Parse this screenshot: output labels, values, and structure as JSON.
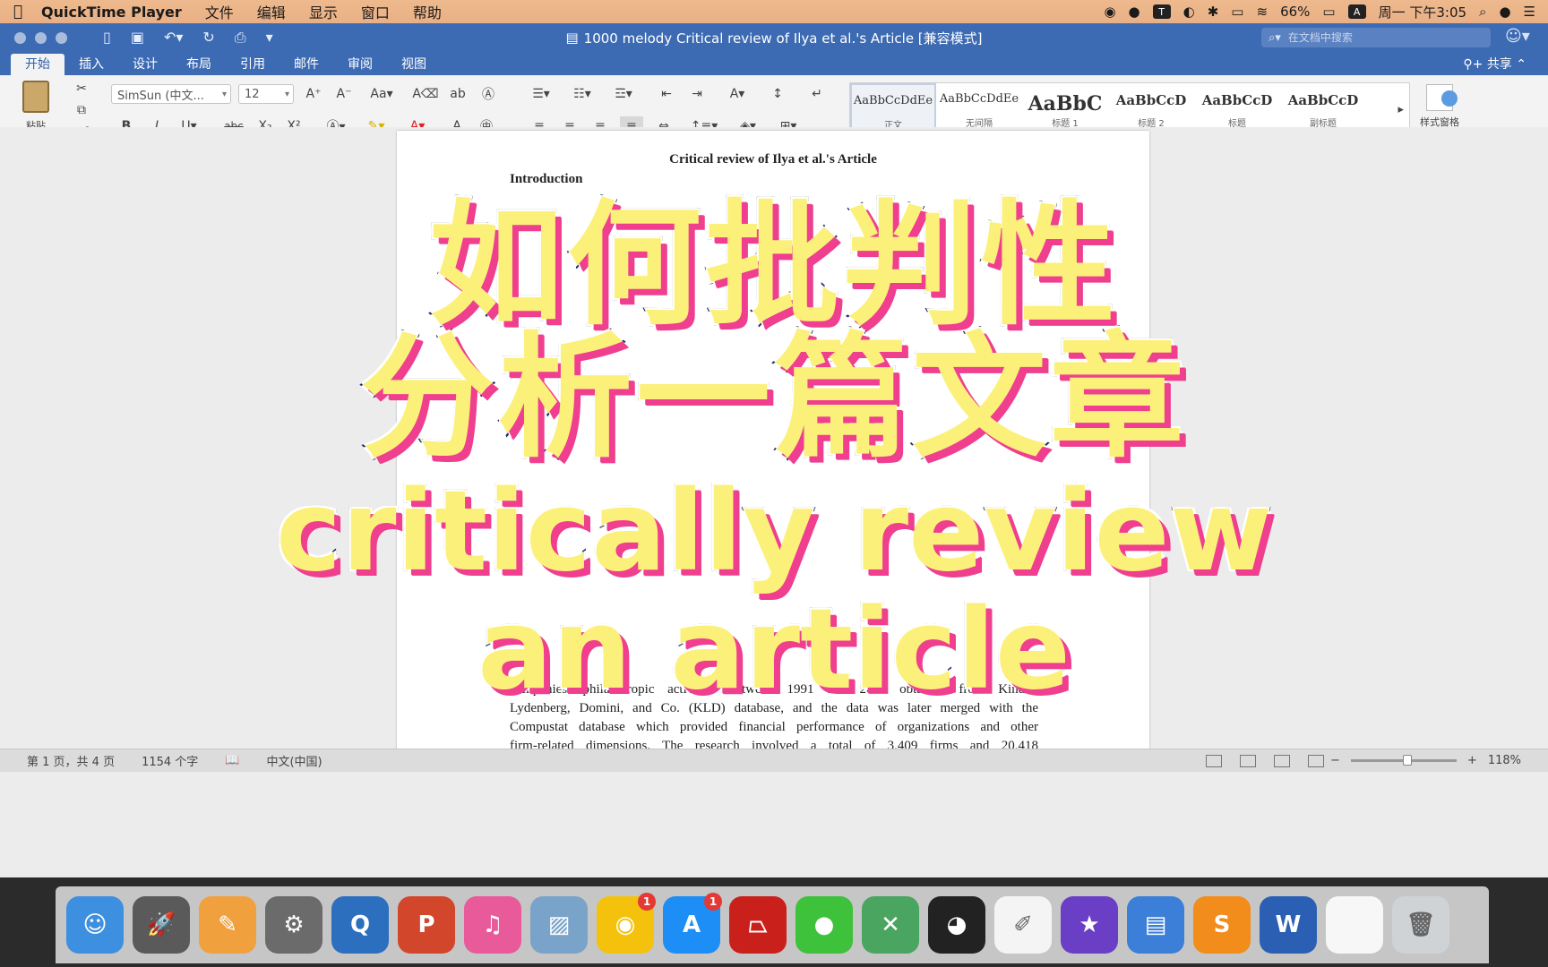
{
  "menubar": {
    "app_name": "QuickTime Player",
    "items": [
      "文件",
      "编辑",
      "显示",
      "窗口",
      "帮助"
    ],
    "battery": "66%",
    "clock": "周一 下午3:05"
  },
  "window": {
    "title": "1000 melody  Critical review of Ilya et al.'s Article [兼容模式]",
    "search_placeholder": "在文档中搜索",
    "tabs": [
      "开始",
      "插入",
      "设计",
      "布局",
      "引用",
      "邮件",
      "审阅",
      "视图"
    ],
    "share": "共享"
  },
  "ribbon": {
    "paste": "粘贴",
    "font_name": "SimSun (中文...",
    "font_size": "12",
    "styles": [
      {
        "sample": "AaBbCcDdEe",
        "name": "正文"
      },
      {
        "sample": "AaBbCcDdEe",
        "name": "无间隔"
      },
      {
        "sample": "AaBbC",
        "name": "标题 1"
      },
      {
        "sample": "AaBbCcD",
        "name": "标题 2"
      },
      {
        "sample": "AaBbCcD",
        "name": "标题"
      },
      {
        "sample": "AaBbCcD",
        "name": "副标题"
      }
    ],
    "style_pane": "样式窗格"
  },
  "document": {
    "title": "Critical review of Ilya et al.'s Article",
    "heading": "Introduction",
    "lines": [
      "companies' philanthropic activities between 1991 and 2009 obtained from Kinder,",
      "Lydenberg, Domini, and Co. (KLD) database, and the data was later merged with the",
      "Compustat database which provided financial performance of organizations and other",
      "firm-related dimensions. The research involved a total of 3,409 firms and 20,418"
    ]
  },
  "overlay": {
    "line1": "如何批判性",
    "line2": "分析一篇文章",
    "line3": "critically review",
    "line4": "an article"
  },
  "status": {
    "page": "第 1 页，共 4 页",
    "words": "1154 个字",
    "language": "中文(中国)",
    "zoom": "118%"
  },
  "dock": {
    "apps": [
      {
        "icon": "finder-icon",
        "color": "#3d8fe0"
      },
      {
        "icon": "launchpad-icon",
        "color": "#5a5a5a"
      },
      {
        "icon": "pages-icon",
        "color": "#f0a03c"
      },
      {
        "icon": "system-preferences-icon",
        "color": "#6b6b6b"
      },
      {
        "icon": "quicktime-icon",
        "color": "#2c6fbf"
      },
      {
        "icon": "powerpoint-icon",
        "color": "#d2472b"
      },
      {
        "icon": "itunes-icon",
        "color": "#e85a9a"
      },
      {
        "icon": "preview-icon",
        "color": "#7aa3c9"
      },
      {
        "icon": "chrome-icon",
        "color": "#f4c20d"
      },
      {
        "icon": "app-store-icon",
        "color": "#1d8ef5"
      },
      {
        "icon": "acrobat-icon",
        "color": "#c9201c"
      },
      {
        "icon": "wechat-icon",
        "color": "#3ec13b"
      },
      {
        "icon": "network-icon",
        "color": "#4aa561"
      },
      {
        "icon": "qq-icon",
        "color": "#222222"
      },
      {
        "icon": "textedit-icon",
        "color": "#f4f4f4"
      },
      {
        "icon": "imovie-icon",
        "color": "#6a3fc6"
      },
      {
        "icon": "keynote-icon",
        "color": "#3b7fd8"
      },
      {
        "icon": "sublime-icon",
        "color": "#f28c1b"
      },
      {
        "icon": "word-icon",
        "color": "#2b5fb3"
      },
      {
        "icon": "blank-window-icon",
        "color": "#f7f7f7"
      },
      {
        "icon": "trash-icon",
        "color": "#cfd3d6"
      }
    ],
    "badges": {
      "app_store": "1",
      "chrome": "1"
    }
  }
}
